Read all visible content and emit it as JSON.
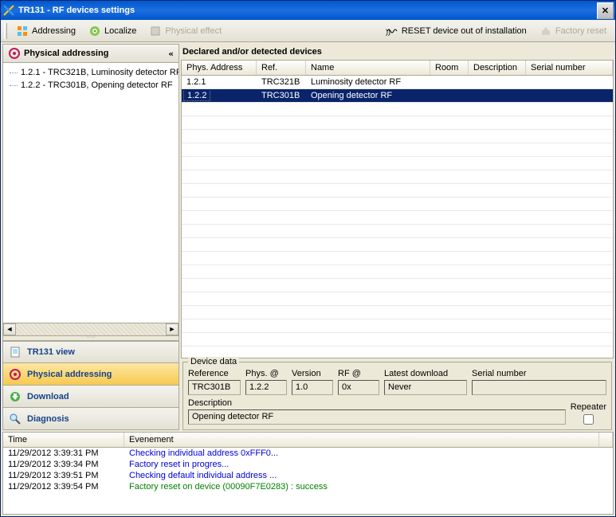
{
  "titlebar": {
    "title": "TR131 - RF devices settings"
  },
  "toolbar": {
    "addressing": "Addressing",
    "localize": "Localize",
    "physical_effect": "Physical effect",
    "reset_out": "RESET device out of installation",
    "factory_reset": "Factory reset"
  },
  "sidebar": {
    "header": "Physical addressing",
    "tree": [
      "1.2.1 - TRC321B, Luminosity detector RF",
      "1.2.2 - TRC301B, Opening detector RF"
    ],
    "stack": {
      "tr131_view": "TR131 view",
      "physical_addressing": "Physical addressing",
      "download": "Download",
      "diagnosis": "Diagnosis"
    }
  },
  "grid": {
    "title": "Declared and/or detected devices",
    "cols": {
      "addr": "Phys. Address",
      "ref": "Ref.",
      "name": "Name",
      "room": "Room",
      "desc": "Description",
      "serial": "Serial number"
    },
    "rows": [
      {
        "addr": "1.2.1",
        "ref": "TRC321B",
        "name": "Luminosity detector RF",
        "room": "",
        "desc": "",
        "serial": "",
        "selected": false
      },
      {
        "addr": "1.2.2",
        "ref": "TRC301B",
        "name": "Opening detector RF",
        "room": "",
        "desc": "",
        "serial": "",
        "selected": true
      }
    ]
  },
  "device_data": {
    "legend": "Device data",
    "labels": {
      "reference": "Reference",
      "phys": "Phys. @",
      "version": "Version",
      "rf": "RF @",
      "latest": "Latest download",
      "serial": "Serial number",
      "description": "Description",
      "repeater": "Repeater"
    },
    "values": {
      "reference": "TRC301B",
      "phys": "1.2.2",
      "version": "1.0",
      "rf": "0x",
      "latest": "Never",
      "serial": "",
      "description": "Opening detector RF",
      "repeater": false
    }
  },
  "log": {
    "cols": {
      "time": "Time",
      "event": "Evenement"
    },
    "rows": [
      {
        "time": "11/29/2012 3:39:31 PM",
        "text": "Checking individual address 0xFFF0...",
        "color": "blue"
      },
      {
        "time": "11/29/2012 3:39:34 PM",
        "text": "Factory reset in progres...",
        "color": "blue"
      },
      {
        "time": "11/29/2012 3:39:51 PM",
        "text": "Checking default individual address ...",
        "color": "blue"
      },
      {
        "time": "11/29/2012 3:39:54 PM",
        "text": "Factory reset on device (00090F7E0283) : success",
        "color": "green"
      }
    ]
  }
}
